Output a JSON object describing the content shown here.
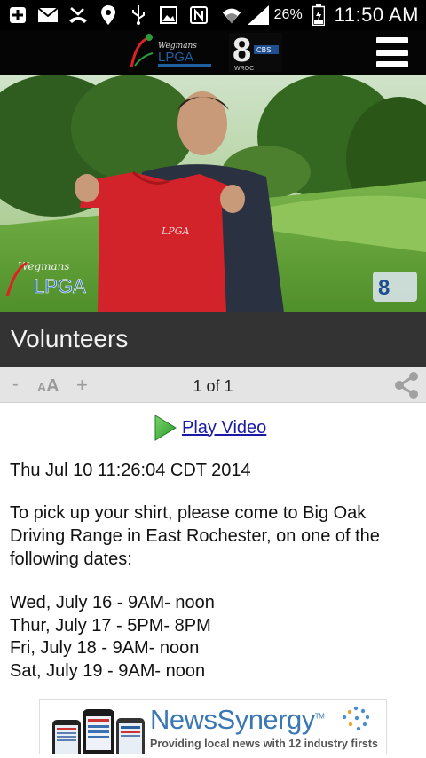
{
  "status_bar": {
    "icons": [
      "plus-icon",
      "mail-icon",
      "missed-call-icon",
      "location-icon",
      "usb-icon",
      "image-icon",
      "nfc-icon",
      "wifi-icon",
      "signal-icon",
      "battery-icon"
    ],
    "battery_percent": "26%",
    "time": "11:50 AM"
  },
  "header": {
    "logo_left": "Wegmans LPGA Championship",
    "logo_right": "8 WROC",
    "menu_icon": "hamburger-menu-icon"
  },
  "article": {
    "title": "Volunteers",
    "toolbar": {
      "decrease_label": "-",
      "font_small": "A",
      "font_big": "A",
      "increase_label": "+",
      "page_indicator": "1 of 1",
      "share_icon": "share-icon"
    },
    "play_video_label": "Play Video",
    "date": "Thu Jul 10 11:26:04 CDT 2014",
    "body": "To pick up your shirt, please come to Big Oak Driving Range in East Rochester, on one of the following dates:",
    "schedule": [
      "Wed, July 16 - 9AM- noon",
      "Thur, July 17 - 5PM- 8PM",
      "Fri, July 18 - 9AM- noon",
      "Sat, July 19 - 9AM- noon"
    ]
  },
  "ad": {
    "brand": "NewsSynergy",
    "tm": "TM",
    "tagline": "Providing local news with 12 industry firsts"
  },
  "colors": {
    "title_band": "#333333",
    "toolbar": "#e4e4e4",
    "link": "#1a1aa6",
    "play_green": "#3cb33c",
    "ad_blue": "#3a77b5"
  }
}
